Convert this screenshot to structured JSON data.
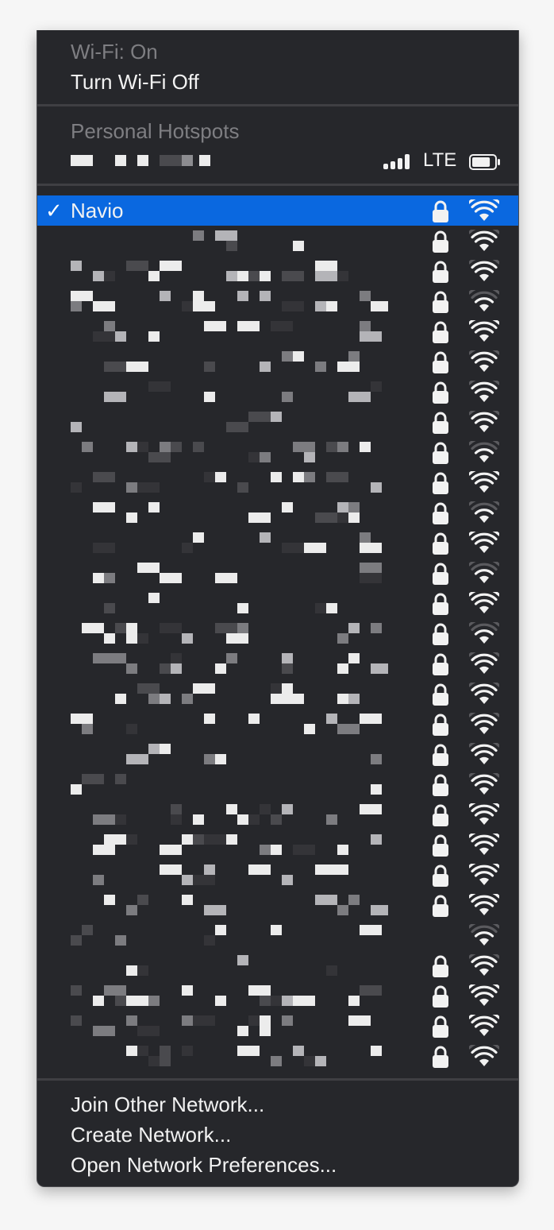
{
  "wifi": {
    "status_label": "Wi-Fi: On",
    "toggle_label": "Turn Wi-Fi Off"
  },
  "hotspots": {
    "header": "Personal Hotspots",
    "device": {
      "connection_type": "LTE",
      "signal_bars": 4,
      "battery_level": 0.85
    }
  },
  "networks": [
    {
      "name": "Navio",
      "selected": true,
      "secure": true,
      "strength": 3,
      "redacted": false
    },
    {
      "name": "",
      "secure": true,
      "strength": 2,
      "redacted": true
    },
    {
      "name": "",
      "secure": true,
      "strength": 2,
      "redacted": true
    },
    {
      "name": "",
      "secure": true,
      "strength": 1,
      "redacted": true
    },
    {
      "name": "",
      "secure": true,
      "strength": 3,
      "redacted": true
    },
    {
      "name": "",
      "secure": true,
      "strength": 2,
      "redacted": true
    },
    {
      "name": "",
      "secure": true,
      "strength": 2,
      "redacted": true
    },
    {
      "name": "",
      "secure": true,
      "strength": 2,
      "redacted": true
    },
    {
      "name": "",
      "secure": true,
      "strength": 1,
      "redacted": true
    },
    {
      "name": "",
      "secure": true,
      "strength": 3,
      "redacted": true
    },
    {
      "name": "",
      "secure": true,
      "strength": 1,
      "redacted": true
    },
    {
      "name": "",
      "secure": true,
      "strength": 3,
      "redacted": true
    },
    {
      "name": "",
      "secure": true,
      "strength": 1,
      "redacted": true
    },
    {
      "name": "",
      "secure": true,
      "strength": 3,
      "redacted": true
    },
    {
      "name": "",
      "secure": true,
      "strength": 1,
      "redacted": true
    },
    {
      "name": "",
      "secure": true,
      "strength": 2,
      "redacted": true
    },
    {
      "name": "",
      "secure": true,
      "strength": 2,
      "redacted": true
    },
    {
      "name": "",
      "secure": true,
      "strength": 2,
      "redacted": true
    },
    {
      "name": "",
      "secure": true,
      "strength": 2,
      "redacted": true
    },
    {
      "name": "",
      "secure": true,
      "strength": 2,
      "redacted": true
    },
    {
      "name": "",
      "secure": true,
      "strength": 3,
      "redacted": true
    },
    {
      "name": "",
      "secure": true,
      "strength": 3,
      "redacted": true
    },
    {
      "name": "",
      "secure": true,
      "strength": 3,
      "redacted": true
    },
    {
      "name": "",
      "secure": true,
      "strength": 3,
      "redacted": true
    },
    {
      "name": "",
      "secure": false,
      "strength": 1,
      "redacted": true
    },
    {
      "name": "",
      "secure": true,
      "strength": 2,
      "redacted": true
    },
    {
      "name": "",
      "secure": true,
      "strength": 3,
      "redacted": true
    },
    {
      "name": "",
      "secure": true,
      "strength": 3,
      "redacted": true
    },
    {
      "name": "",
      "secure": true,
      "strength": 2,
      "redacted": true
    }
  ],
  "actions": {
    "join_other": "Join Other Network...",
    "create": "Create Network...",
    "preferences": "Open Network Preferences..."
  },
  "colors": {
    "menu_bg": "#26272b",
    "selection": "#0a68e0",
    "text": "#f2f2f2",
    "disabled_text": "#7e7e82",
    "dim_arc": "#5a5a5e"
  },
  "icons": {
    "check": "checkmark-icon",
    "lock": "lock-icon",
    "wifi": "wifi-signal-icon",
    "cell": "cellular-signal-icon",
    "battery": "battery-icon"
  }
}
